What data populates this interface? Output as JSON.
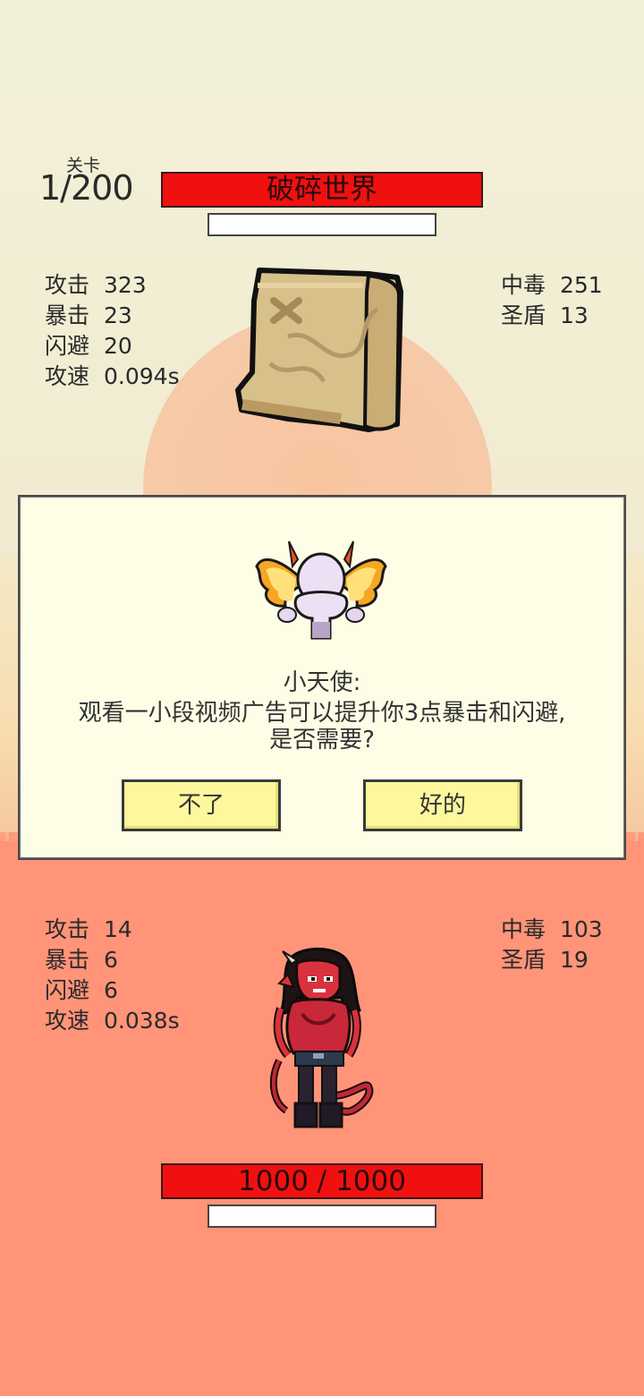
{
  "level": {
    "caption": "关卡",
    "value": "1/200"
  },
  "enemy": {
    "name": "破碎世界",
    "stats_left": [
      {
        "label": "攻击",
        "value": "323"
      },
      {
        "label": "暴击",
        "value": "23"
      },
      {
        "label": "闪避",
        "value": "20"
      },
      {
        "label": "攻速",
        "value": "0.094s"
      }
    ],
    "stats_right": [
      {
        "label": "中毒",
        "value": "251"
      },
      {
        "label": "圣盾",
        "value": "13"
      }
    ]
  },
  "dialog": {
    "speaker": "小天使:",
    "message": "观看一小段视频广告可以提升你3点暴击和闪避,",
    "question": "是否需要?",
    "decline_label": "不了",
    "accept_label": "好的"
  },
  "player": {
    "hp": "1000 / 1000",
    "stats_left": [
      {
        "label": "攻击",
        "value": "14"
      },
      {
        "label": "暴击",
        "value": "6"
      },
      {
        "label": "闪避",
        "value": "6"
      },
      {
        "label": "攻速",
        "value": "0.038s"
      }
    ],
    "stats_right": [
      {
        "label": "中毒",
        "value": "103"
      },
      {
        "label": "圣盾",
        "value": "19"
      }
    ]
  },
  "colors": {
    "bar_red": "#f01010",
    "dialog_bg": "#fefde6",
    "button_bg": "#fdf79e",
    "ground": "#ff9478"
  },
  "icons": [
    "treasure-map-icon",
    "angel-icon",
    "devil-girl-icon"
  ]
}
